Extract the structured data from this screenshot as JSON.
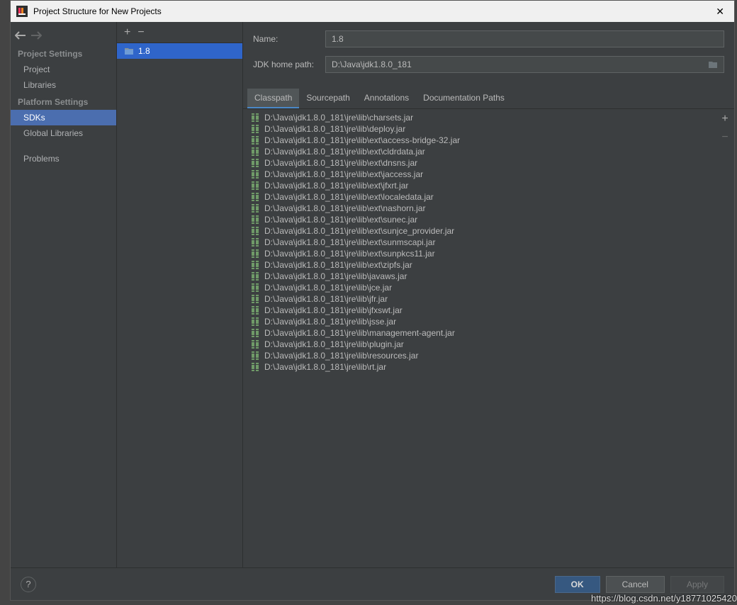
{
  "window": {
    "title": "Project Structure for New Projects"
  },
  "sidebar": {
    "groups": [
      {
        "heading": "Project Settings",
        "items": [
          "Project",
          "Libraries"
        ],
        "selectedIndex": -1
      },
      {
        "heading": "Platform Settings",
        "items": [
          "SDKs",
          "Global Libraries"
        ],
        "selectedIndex": 0
      },
      {
        "heading": "",
        "items": [
          "Problems"
        ],
        "selectedIndex": -1
      }
    ]
  },
  "sdkList": {
    "items": [
      {
        "name": "1.8"
      }
    ],
    "selectedIndex": 0
  },
  "form": {
    "name_label": "Name:",
    "name_value": "1.8",
    "path_label": "JDK home path:",
    "path_value": "D:\\Java\\jdk1.8.0_181"
  },
  "tabs": {
    "items": [
      "Classpath",
      "Sourcepath",
      "Annotations",
      "Documentation Paths"
    ],
    "activeIndex": 0
  },
  "files": [
    "D:\\Java\\jdk1.8.0_181\\jre\\lib\\charsets.jar",
    "D:\\Java\\jdk1.8.0_181\\jre\\lib\\deploy.jar",
    "D:\\Java\\jdk1.8.0_181\\jre\\lib\\ext\\access-bridge-32.jar",
    "D:\\Java\\jdk1.8.0_181\\jre\\lib\\ext\\cldrdata.jar",
    "D:\\Java\\jdk1.8.0_181\\jre\\lib\\ext\\dnsns.jar",
    "D:\\Java\\jdk1.8.0_181\\jre\\lib\\ext\\jaccess.jar",
    "D:\\Java\\jdk1.8.0_181\\jre\\lib\\ext\\jfxrt.jar",
    "D:\\Java\\jdk1.8.0_181\\jre\\lib\\ext\\localedata.jar",
    "D:\\Java\\jdk1.8.0_181\\jre\\lib\\ext\\nashorn.jar",
    "D:\\Java\\jdk1.8.0_181\\jre\\lib\\ext\\sunec.jar",
    "D:\\Java\\jdk1.8.0_181\\jre\\lib\\ext\\sunjce_provider.jar",
    "D:\\Java\\jdk1.8.0_181\\jre\\lib\\ext\\sunmscapi.jar",
    "D:\\Java\\jdk1.8.0_181\\jre\\lib\\ext\\sunpkcs11.jar",
    "D:\\Java\\jdk1.8.0_181\\jre\\lib\\ext\\zipfs.jar",
    "D:\\Java\\jdk1.8.0_181\\jre\\lib\\javaws.jar",
    "D:\\Java\\jdk1.8.0_181\\jre\\lib\\jce.jar",
    "D:\\Java\\jdk1.8.0_181\\jre\\lib\\jfr.jar",
    "D:\\Java\\jdk1.8.0_181\\jre\\lib\\jfxswt.jar",
    "D:\\Java\\jdk1.8.0_181\\jre\\lib\\jsse.jar",
    "D:\\Java\\jdk1.8.0_181\\jre\\lib\\management-agent.jar",
    "D:\\Java\\jdk1.8.0_181\\jre\\lib\\plugin.jar",
    "D:\\Java\\jdk1.8.0_181\\jre\\lib\\resources.jar",
    "D:\\Java\\jdk1.8.0_181\\jre\\lib\\rt.jar"
  ],
  "footer": {
    "ok": "OK",
    "cancel": "Cancel",
    "apply": "Apply"
  },
  "watermark": "https://blog.csdn.net/y18771025420"
}
